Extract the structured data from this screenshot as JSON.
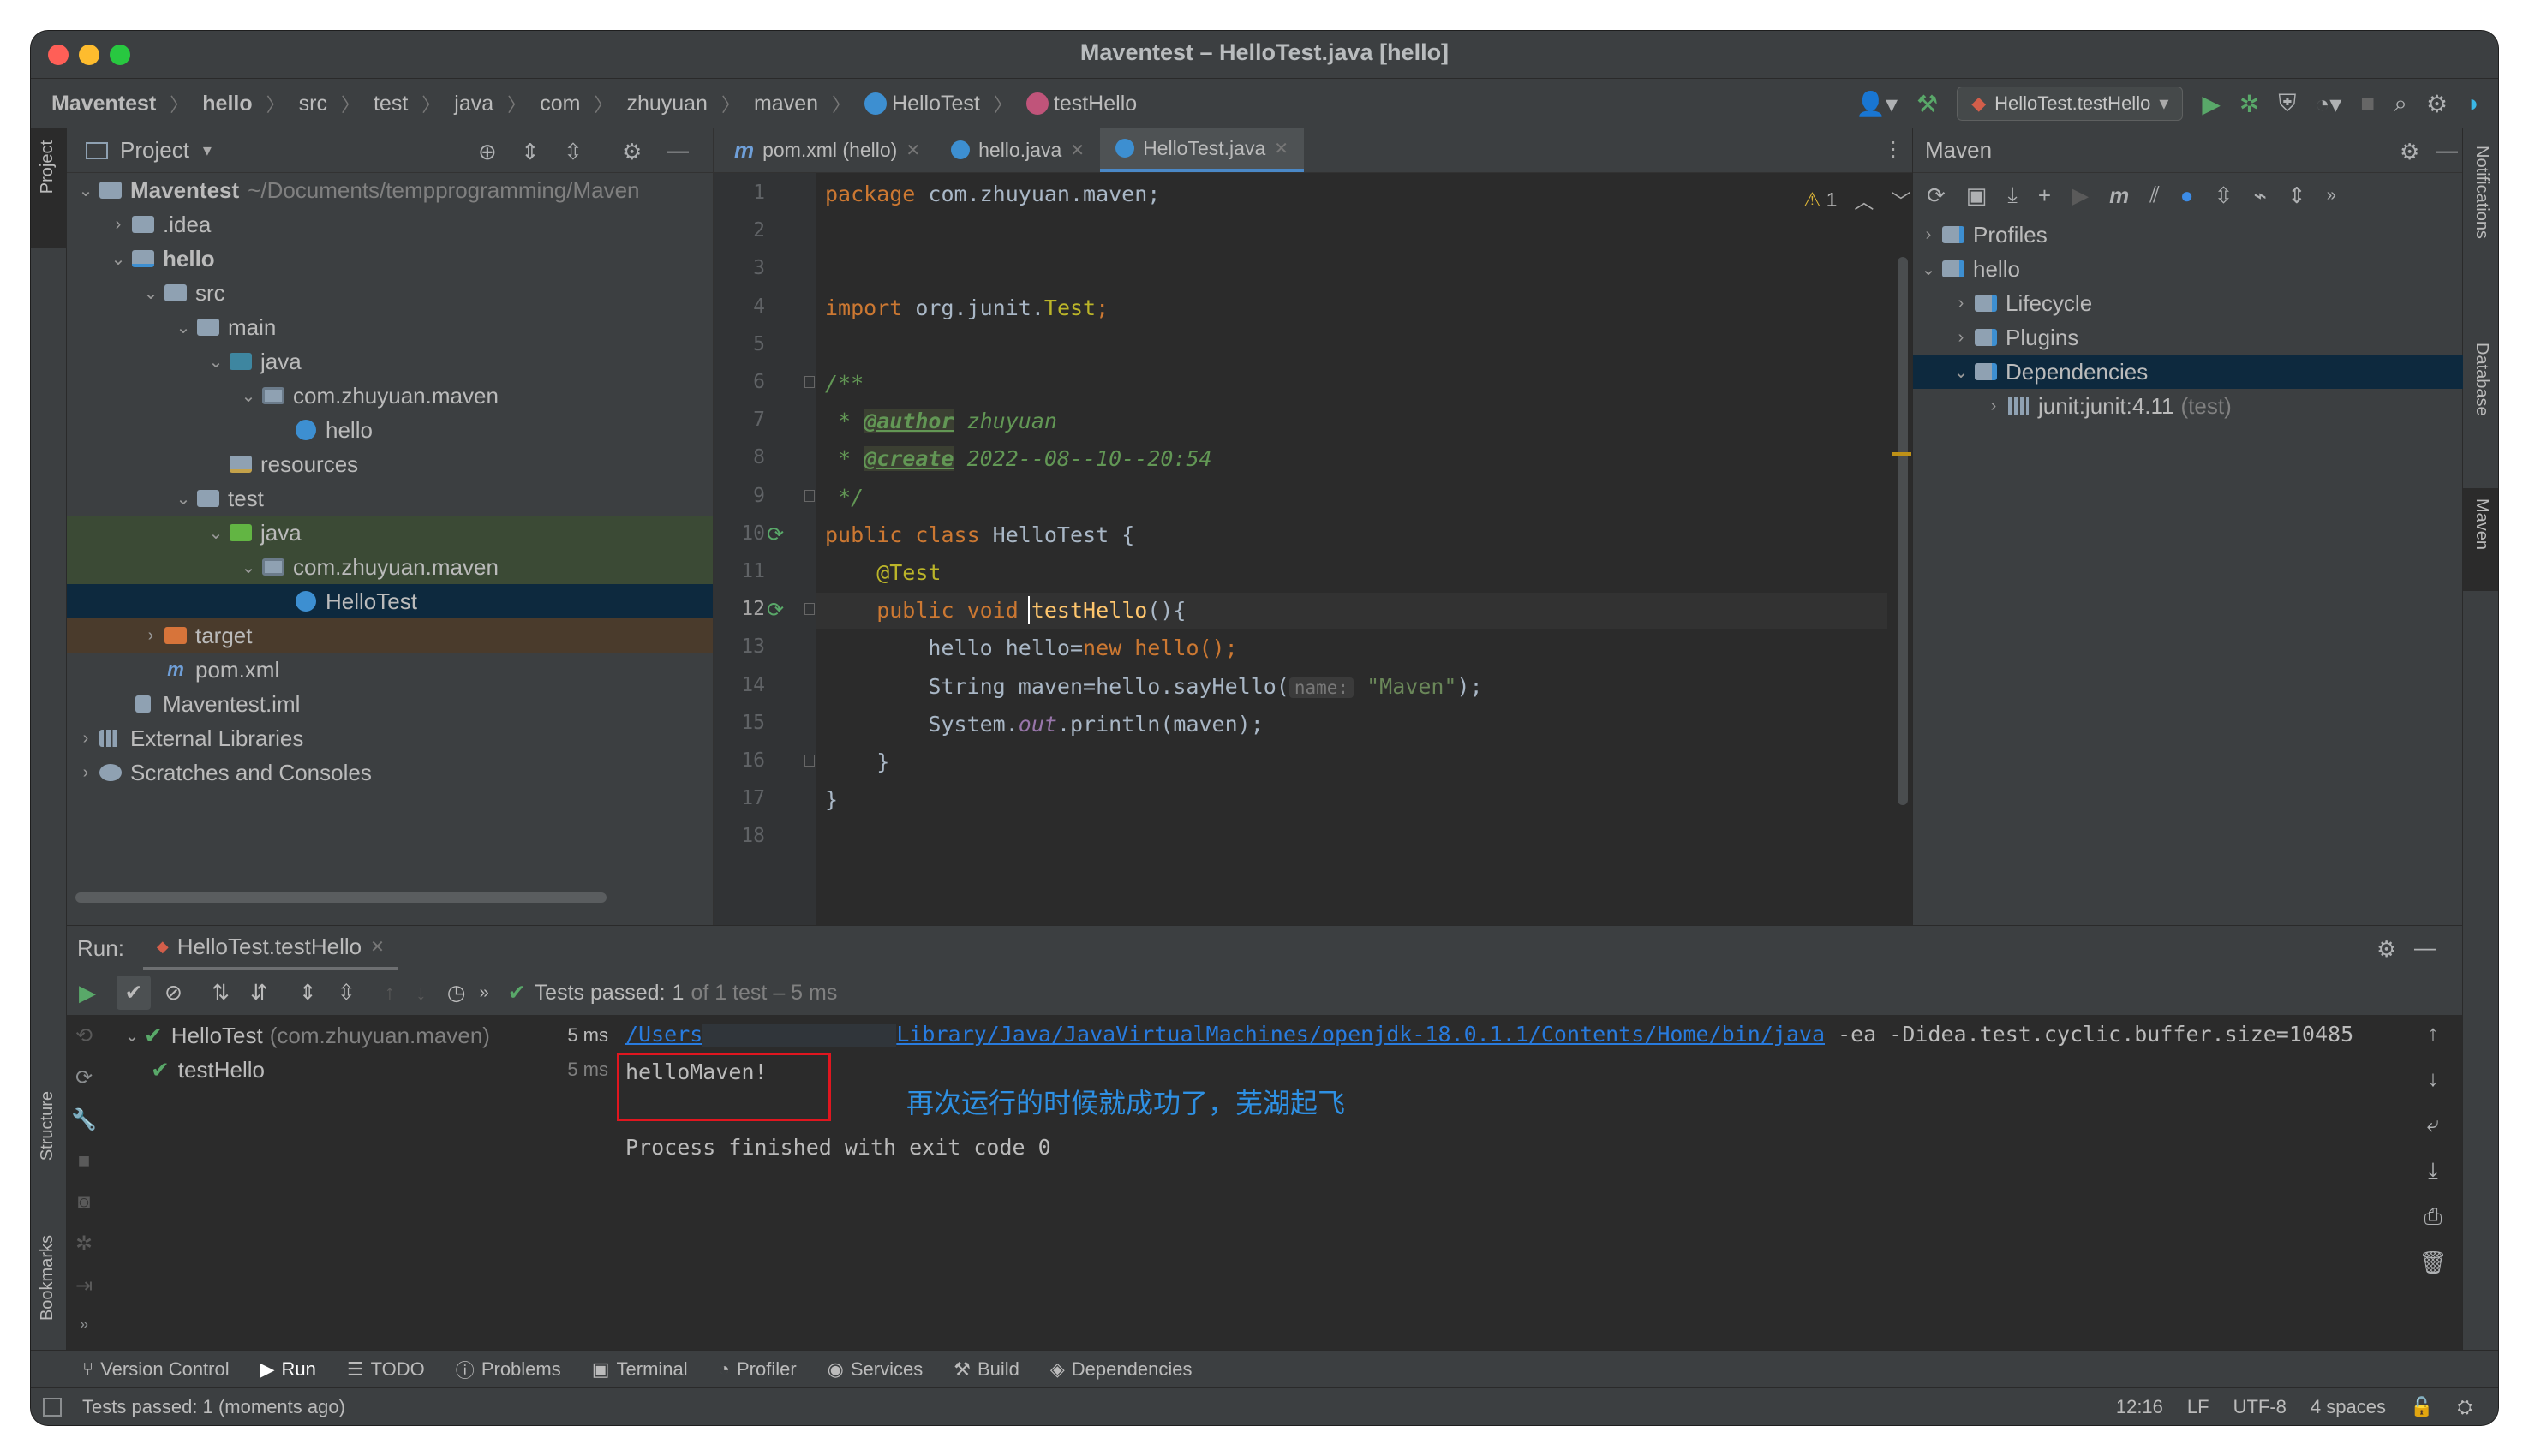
{
  "window": {
    "title": "Maventest – HelloTest.java [hello]",
    "traffic_colors": {
      "close": "#ff5f57",
      "minimize": "#febc2e",
      "zoom": "#28c840"
    }
  },
  "breadcrumb": [
    "Maventest",
    "hello",
    "src",
    "test",
    "java",
    "com",
    "zhuyuan",
    "maven",
    "HelloTest",
    "testHello"
  ],
  "run_config": {
    "label": "HelloTest.testHello"
  },
  "left_stripe": {
    "project": "Project",
    "structure": "Structure",
    "bookmarks": "Bookmarks"
  },
  "right_stripe": {
    "notifications": "Notifications",
    "database": "Database",
    "maven": "Maven"
  },
  "project_panel": {
    "title": "Project",
    "tree": [
      {
        "label": "Maventest",
        "suffix": "~/Documents/tempprogramming/Maven",
        "level": 0,
        "arrow": "down",
        "icon": "folder-icon",
        "bold": true
      },
      {
        "label": ".idea",
        "level": 1,
        "arrow": "right",
        "icon": "folder-icon"
      },
      {
        "label": "hello",
        "level": 1,
        "arrow": "down",
        "icon": "module-folder-icon",
        "bold": true
      },
      {
        "label": "src",
        "level": 2,
        "arrow": "down",
        "icon": "folder-icon"
      },
      {
        "label": "main",
        "level": 3,
        "arrow": "down",
        "icon": "folder-icon"
      },
      {
        "label": "java",
        "level": 4,
        "arrow": "down",
        "icon": "source-folder-icon"
      },
      {
        "label": "com.zhuyuan.maven",
        "level": 5,
        "arrow": "down",
        "icon": "package-icon"
      },
      {
        "label": "hello",
        "level": 6,
        "arrow": "",
        "icon": "java-class-icon"
      },
      {
        "label": "resources",
        "level": 4,
        "arrow": "",
        "icon": "resources-folder-icon"
      },
      {
        "label": "test",
        "level": 3,
        "arrow": "down",
        "icon": "folder-icon"
      },
      {
        "label": "java",
        "level": 4,
        "arrow": "down",
        "icon": "test-folder-icon",
        "highlight": "test"
      },
      {
        "label": "com.zhuyuan.maven",
        "level": 5,
        "arrow": "down",
        "icon": "package-icon",
        "highlight": "test"
      },
      {
        "label": "HelloTest",
        "level": 6,
        "arrow": "",
        "icon": "java-class-icon",
        "highlight": "selected"
      },
      {
        "label": "target",
        "level": 2,
        "arrow": "right",
        "icon": "excluded-folder-icon",
        "highlight": "target"
      },
      {
        "label": "pom.xml",
        "level": 2,
        "arrow": "",
        "icon": "maven-file-icon"
      },
      {
        "label": "Maventest.iml",
        "level": 1,
        "arrow": "",
        "icon": "iml-file-icon"
      },
      {
        "label": "External Libraries",
        "level": 0,
        "arrow": "right",
        "icon": "libraries-icon"
      },
      {
        "label": "Scratches and Consoles",
        "level": 0,
        "arrow": "right",
        "icon": "scratches-icon"
      }
    ]
  },
  "editor": {
    "tabs": [
      {
        "label": "pom.xml (hello)",
        "icon": "maven-file-icon",
        "active": false
      },
      {
        "label": "hello.java",
        "icon": "java-class-icon",
        "active": false
      },
      {
        "label": "HelloTest.java",
        "icon": "java-class-icon",
        "active": true
      }
    ],
    "warning_count": "1",
    "line_numbers": [
      "1",
      "2",
      "3",
      "4",
      "5",
      "6",
      "7",
      "8",
      "9",
      "10",
      "11",
      "12",
      "13",
      "14",
      "15",
      "16",
      "17",
      "18"
    ],
    "code": {
      "l1_kw": "package",
      "l1_rest": " com.zhuyuan.maven;",
      "l4_kw": "import",
      "l4_rest": " org.junit.",
      "l4_cls": "Test",
      "l4_end": ";",
      "l6": "/**",
      "l7_pre": " * ",
      "l7_tag": "@author",
      "l7_val": " zhuyuan",
      "l8_pre": " * ",
      "l8_tag": "@create",
      "l8_val": " 2022--08--10--20:54",
      "l9": " */",
      "l10_kw": "public class",
      "l10_rest": " HelloTest {",
      "l11": "    @Test",
      "l12_kw": "    public void",
      "l12_fn": " testHello",
      "l12_rest": "(){",
      "l13_a": "        hello hello=",
      "l13_kw": "new",
      "l13_b": " hello();",
      "l14_a": "        String maven=hello.sayHello(",
      "l14_hint": "name:",
      "l14_str": " \"Maven\"",
      "l14_b": ");",
      "l15_a": "        System.",
      "l15_fld": "out",
      "l15_b": ".println(maven);",
      "l16": "    }",
      "l17": "}"
    }
  },
  "maven_panel": {
    "title": "Maven",
    "tree": [
      {
        "label": "Profiles",
        "level": 0,
        "arrow": "right",
        "icon": "profiles-icon"
      },
      {
        "label": "hello",
        "level": 0,
        "arrow": "down",
        "icon": "maven-project-icon"
      },
      {
        "label": "Lifecycle",
        "level": 1,
        "arrow": "right",
        "icon": "lifecycle-icon"
      },
      {
        "label": "Plugins",
        "level": 1,
        "arrow": "right",
        "icon": "plugins-icon"
      },
      {
        "label": "Dependencies",
        "level": 1,
        "arrow": "down",
        "icon": "dependencies-icon",
        "selected": true
      },
      {
        "label": "junit:junit:4.11",
        "suffix": "(test)",
        "level": 2,
        "arrow": "right",
        "icon": "library-icon"
      }
    ]
  },
  "run_panel": {
    "label": "Run:",
    "tab": "HelloTest.testHello",
    "status_prefix": "Tests passed:",
    "status_count": "1",
    "status_suffix": "of 1 test – 5 ms",
    "tests": [
      {
        "name": "HelloTest",
        "detail": "(com.zhuyuan.maven)",
        "time": "5 ms",
        "level": 0
      },
      {
        "name": "testHello",
        "detail": "",
        "time": "5 ms",
        "level": 1
      }
    ],
    "console": {
      "cmd_link_a": "/Users",
      "cmd_link_b": "Library/Java/JavaVirtualMachines/openjdk-18.0.1.1/Contents/Home/bin/java",
      "cmd_rest": " -ea -Didea.test.cyclic.buffer.size=10485",
      "output": "helloMaven!",
      "annotation": "再次运行的时候就成功了，芜湖起飞",
      "exit": "Process finished with exit code 0"
    }
  },
  "bottom_tabs": [
    {
      "label": "Version Control",
      "icon": "vcs-icon"
    },
    {
      "label": "Run",
      "icon": "run-icon",
      "active": true
    },
    {
      "label": "TODO",
      "icon": "todo-icon"
    },
    {
      "label": "Problems",
      "icon": "problems-icon"
    },
    {
      "label": "Terminal",
      "icon": "terminal-icon"
    },
    {
      "label": "Profiler",
      "icon": "profiler-icon"
    },
    {
      "label": "Services",
      "icon": "services-icon"
    },
    {
      "label": "Build",
      "icon": "build-icon"
    },
    {
      "label": "Dependencies",
      "icon": "dependencies-icon"
    }
  ],
  "status_bar": {
    "message": "Tests passed: 1 (moments ago)",
    "position": "12:16",
    "line_sep": "LF",
    "encoding": "UTF-8",
    "indent": "4 spaces"
  }
}
